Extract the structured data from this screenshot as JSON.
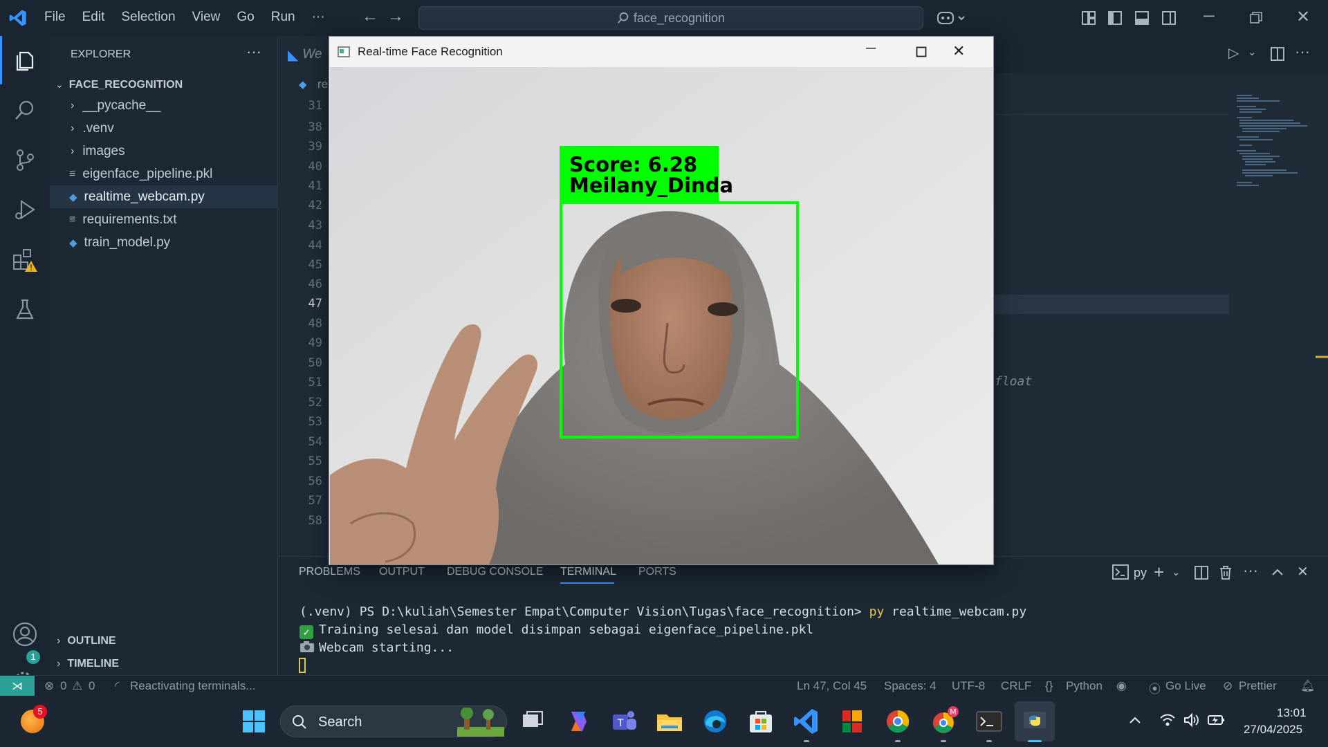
{
  "titlebar": {
    "menu": [
      "File",
      "Edit",
      "Selection",
      "View",
      "Go",
      "Run",
      "···"
    ],
    "search": "face_recognition"
  },
  "sidebar": {
    "title": "EXPLORER",
    "more": "···",
    "folder": "FACE_RECOGNITION",
    "items": [
      {
        "label": "__pycache__",
        "type": "folder"
      },
      {
        "label": ".venv",
        "type": "folder"
      },
      {
        "label": "images",
        "type": "folder"
      },
      {
        "label": "eigenface_pipeline.pkl",
        "type": "file"
      },
      {
        "label": "realtime_webcam.py",
        "type": "py",
        "selected": true
      },
      {
        "label": "requirements.txt",
        "type": "file"
      },
      {
        "label": "train_model.py",
        "type": "py"
      }
    ],
    "outline": "OUTLINE",
    "timeline": "TIMELINE"
  },
  "editor": {
    "tab_partial": "We",
    "breadcrumb_partial": "re",
    "line_numbers": [
      "31",
      "38",
      "39",
      "40",
      "41",
      "42",
      "43",
      "44",
      "45",
      "46",
      "47",
      "48",
      "49",
      "50",
      "51",
      "52",
      "53",
      "54",
      "55",
      "56",
      "57",
      "58"
    ],
    "current_line": "47",
    "code_fragment": "float"
  },
  "window": {
    "title": "Real-time Face Recognition",
    "overlay_score": "Score: 6.28",
    "overlay_name": "Meilany_Dinda"
  },
  "panel": {
    "tabs": [
      "PROBLEMS",
      "OUTPUT",
      "DEBUG CONSOLE",
      "TERMINAL",
      "PORTS"
    ],
    "active_tab": "TERMINAL",
    "shell": "py",
    "lines": [
      {
        "prompt": "(.venv) PS D:\\kuliah\\Semester Empat\\Computer Vision\\Tugas\\face_recognition> ",
        "cmd": "py",
        "args": " realtime_webcam.py"
      },
      {
        "icon": "check",
        "text": "Training selesai dan model disimpan sebagai eigenface_pipeline.pkl"
      },
      {
        "icon": "camera",
        "text": "Webcam starting..."
      }
    ]
  },
  "status": {
    "errors": "0",
    "warnings": "0",
    "message": "Reactivating terminals...",
    "position": "Ln 47, Col 45",
    "spaces": "Spaces: 4",
    "encoding": "UTF-8",
    "eol": "CRLF",
    "language": "Python",
    "golive": "Go Live",
    "prettier": "Prettier"
  },
  "taskbar": {
    "search": "Search",
    "notification_count": "5",
    "time": "13:01",
    "date": "27/04/2025"
  },
  "badges": {
    "settings": "1"
  },
  "colors": {
    "accent": "#3794ff",
    "detection": "#00ff00"
  }
}
